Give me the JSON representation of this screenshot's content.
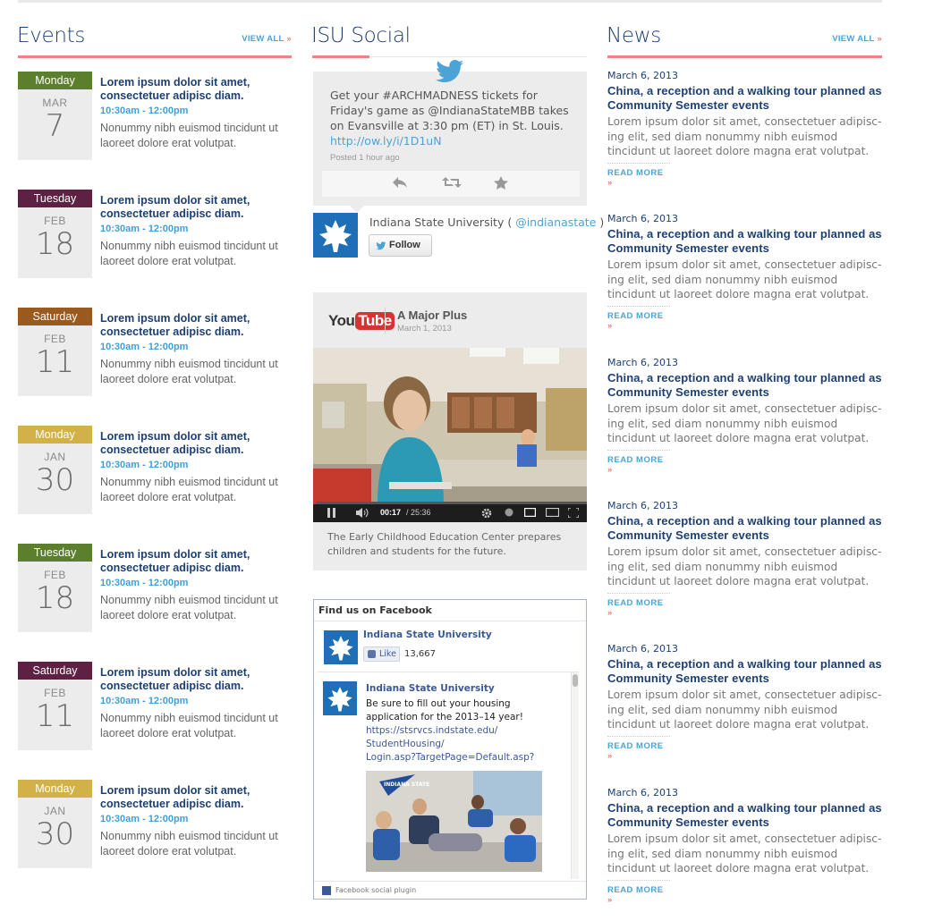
{
  "colors": {
    "heading_blue": "#1d3f72",
    "link_blue": "#4ba3d6",
    "accent_red": "#e98585"
  },
  "events": {
    "heading": "Events",
    "view_all": "VIEW ALL",
    "items": [
      {
        "day": "Monday",
        "month": "MAR",
        "date": "7",
        "color": "#5c7f2e",
        "title": "Lorem ipsum dolor sit amet, consectetuer adipisc diam.",
        "time": "10:30am - 12:00pm",
        "desc": "Nonummy nibh euismod tincidunt ut laoreet dolore erat volutpat."
      },
      {
        "day": "Tuesday",
        "month": "FEB",
        "date": "18",
        "color": "#5e2143",
        "title": "Lorem ipsum dolor sit amet, consectetuer adipisc diam.",
        "time": "10:30am - 12:00pm",
        "desc": "Nonummy nibh euismod tincidunt ut laoreet dolore erat volutpat."
      },
      {
        "day": "Saturday",
        "month": "FEB",
        "date": "11",
        "color": "#9a5a1e",
        "title": "Lorem ipsum dolor sit amet, consectetuer adipisc diam.",
        "time": "10:30am - 12:00pm",
        "desc": "Nonummy nibh euismod tincidunt ut laoreet dolore erat volutpat."
      },
      {
        "day": "Monday",
        "month": "JAN",
        "date": "30",
        "color": "#d2b146",
        "title": "Lorem ipsum dolor sit amet, consectetuer adipisc diam.",
        "time": "10:30am - 12:00pm",
        "desc": "Nonummy nibh euismod tincidunt ut laoreet dolore erat volutpat."
      },
      {
        "day": "Tuesday",
        "month": "FEB",
        "date": "18",
        "color": "#5c7f2e",
        "title": "Lorem ipsum dolor sit amet, consectetuer adipisc diam.",
        "time": "10:30am - 12:00pm",
        "desc": "Nonummy nibh euismod tincidunt ut laoreet dolore erat volutpat."
      },
      {
        "day": "Saturday",
        "month": "FEB",
        "date": "11",
        "color": "#5e2143",
        "title": "Lorem ipsum dolor sit amet, consectetuer adipisc diam.",
        "time": "10:30am - 12:00pm",
        "desc": "Nonummy nibh euismod tincidunt ut laoreet dolore erat volutpat."
      },
      {
        "day": "Monday",
        "month": "JAN",
        "date": "30",
        "color": "#d2b146",
        "title": "Lorem ipsum dolor sit amet, consectetuer adipisc diam.",
        "time": "10:30am - 12:00pm",
        "desc": "Nonummy nibh euismod tincidunt ut laoreet dolore erat volutpat."
      }
    ]
  },
  "social": {
    "heading": "ISU Social",
    "tweet": {
      "text": "Get your #ARCHMADNESS tickets for Friday's game as @IndianaStateMBB takes on Evansville at 3:30 pm (ET) in St. Louis.",
      "link": "http://ow.ly/i/1D1uN",
      "posted": "Posted 1 hour ago",
      "account_name": "Indiana State University",
      "handle": "@indianastate",
      "follow_label": "Follow",
      "icons": [
        "reply-icon",
        "retweet-icon",
        "favorite-icon"
      ]
    },
    "youtube": {
      "logo_you": "You",
      "logo_tube": "Tube",
      "title": "A Major Plus",
      "date": "March 1, 2013",
      "time_current": "00:17",
      "time_total": "/ 25:36",
      "progress": 0.011,
      "caption": "The Early Childhood Education Center prepares children and students for the future."
    },
    "facebook": {
      "header": "Find us on Facebook",
      "page_name": "Indiana State University",
      "like_label": "Like",
      "like_count": "13,667",
      "post_author": "Indiana State University",
      "post_text": "Be sure to fill out your housing application for the 2013–14 year!",
      "post_link_1": "https://stsrvcs.indstate.edu/",
      "post_link_2": "StudentHousing/",
      "post_link_3": "Login.asp?TargetPage=Default.asp?",
      "pennant_text": "INDIANA STATE",
      "footer": "Facebook social plugin"
    }
  },
  "news": {
    "heading": "News",
    "view_all": "VIEW ALL",
    "read_more": "READ MORE",
    "items": [
      {
        "date": "March  6, 2013",
        "title": "China, a reception and a walking tour planned as Community Semester events",
        "desc": "Lorem ipsum dolor sit amet, consectetuer adipisc-ing elit, sed diam nonummy nibh euismod tincidunt ut laoreet dolore magna erat volutpat."
      },
      {
        "date": "March  6, 2013",
        "title": "China, a reception and a walking tour planned as Community Semester events",
        "desc": "Lorem ipsum dolor sit amet, consectetuer adipisc-ing elit, sed diam nonummy nibh euismod tincidunt ut laoreet dolore magna erat volutpat."
      },
      {
        "date": "March  6, 2013",
        "title": "China, a reception and a walking tour planned as Community Semester events",
        "desc": "Lorem ipsum dolor sit amet, consectetuer adipisc-ing elit, sed diam nonummy nibh euismod tincidunt ut laoreet dolore magna erat volutpat."
      },
      {
        "date": "March  6, 2013",
        "title": "China, a reception and a walking tour planned as Community Semester events",
        "desc": "Lorem ipsum dolor sit amet, consectetuer adipisc-ing elit, sed diam nonummy nibh euismod tincidunt ut laoreet dolore magna erat volutpat."
      },
      {
        "date": "March  6, 2013",
        "title": "China, a reception and a walking tour planned as Community Semester events",
        "desc": "Lorem ipsum dolor sit amet, consectetuer adipisc-ing elit, sed diam nonummy nibh euismod tincidunt ut laoreet dolore magna erat volutpat."
      },
      {
        "date": "March  6, 2013",
        "title": "China, a reception and a walking tour planned as Community Semester events",
        "desc": "Lorem ipsum dolor sit amet, consectetuer adipisc-ing elit, sed diam nonummy nibh euismod tincidunt ut laoreet dolore magna erat volutpat."
      }
    ]
  }
}
